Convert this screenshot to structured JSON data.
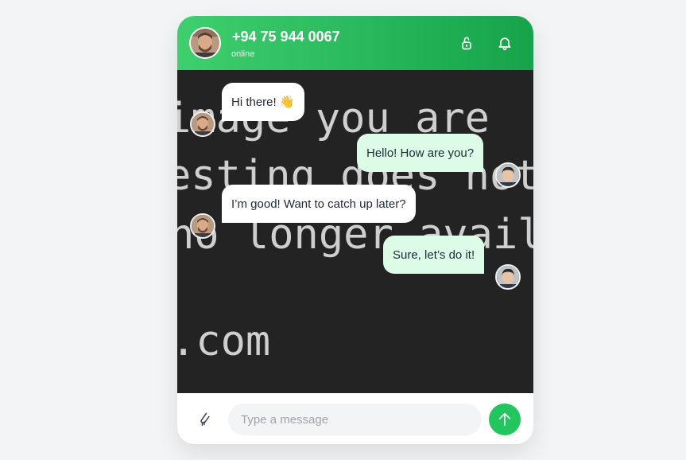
{
  "header": {
    "contact_name": "+94 75 944 0067",
    "status": "online",
    "avatar_icon": "bearded-man-avatar",
    "lock_icon": "lock-icon",
    "bell_icon": "bell-icon",
    "gradient_start": "#3fcf6e",
    "gradient_end": "#16a34a"
  },
  "background": {
    "line1": "image you are",
    "line2": "esting does not",
    "line3": "no longer availa",
    "line4": ".com"
  },
  "messages": [
    {
      "direction": "incoming",
      "text": "Hi there! 👋"
    },
    {
      "direction": "outgoing",
      "text": "Hello! How are you?"
    },
    {
      "direction": "incoming",
      "text": "I’m good! Want to catch up later?"
    },
    {
      "direction": "outgoing",
      "text": "Sure, let’s do it!"
    }
  ],
  "composer": {
    "placeholder": "Type a message",
    "value": "",
    "attach_icon": "paperclip-icon",
    "send_icon": "arrow-up-icon",
    "send_color": "#22c55e"
  },
  "colors": {
    "incoming_bubble": "#ffffff",
    "outgoing_bubble": "#dcfce7",
    "chat_background": "#232323"
  }
}
